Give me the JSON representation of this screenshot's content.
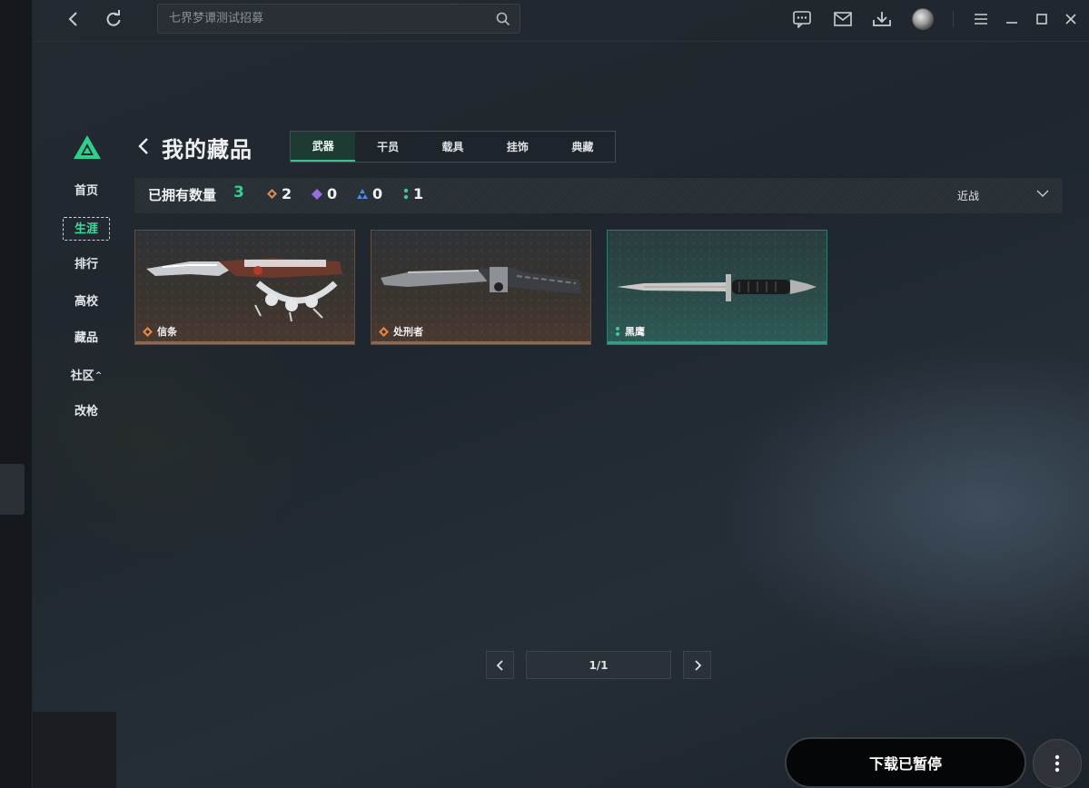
{
  "topbar": {
    "search_placeholder": "七界梦谭测试招募"
  },
  "sidebar": {
    "items": [
      {
        "label": "首页"
      },
      {
        "label": "生涯"
      },
      {
        "label": "排行"
      },
      {
        "label": "高校"
      },
      {
        "label": "藏品"
      },
      {
        "label": "社区"
      },
      {
        "label": "改枪"
      }
    ],
    "active_index": 1
  },
  "header": {
    "title": "我的藏品",
    "tabs": [
      {
        "label": "武器"
      },
      {
        "label": "干员"
      },
      {
        "label": "载具"
      },
      {
        "label": "挂饰"
      },
      {
        "label": "典藏"
      }
    ],
    "active_tab": 0
  },
  "summary": {
    "owned_label": "已拥有数量",
    "owned_total": "3",
    "counts": [
      {
        "icon": "orange-diamond-icon",
        "color": "#e08a4a",
        "value": "2"
      },
      {
        "icon": "purple-diamond-icon",
        "color": "#9b6be0",
        "value": "0"
      },
      {
        "icon": "blue-triangle-icon",
        "color": "#4a8fe0",
        "value": "0"
      },
      {
        "icon": "teal-dots-icon",
        "color": "#3fc9a0",
        "value": "1"
      }
    ],
    "sort_label": "近战"
  },
  "cards": [
    {
      "name": "信条",
      "rarity_color": "#e08a4a",
      "rarity_icon": "orange-diamond-icon"
    },
    {
      "name": "处刑者",
      "rarity_color": "#e08a4a",
      "rarity_icon": "orange-diamond-icon"
    },
    {
      "name": "黑鹰",
      "rarity_color": "#3fc9a0",
      "rarity_icon": "teal-dots-icon"
    }
  ],
  "pagination": {
    "label": "1/1"
  },
  "footer": {
    "download_label": "下载已暂停"
  },
  "colors": {
    "accent": "#3fd89b",
    "background": "#1f262d"
  }
}
